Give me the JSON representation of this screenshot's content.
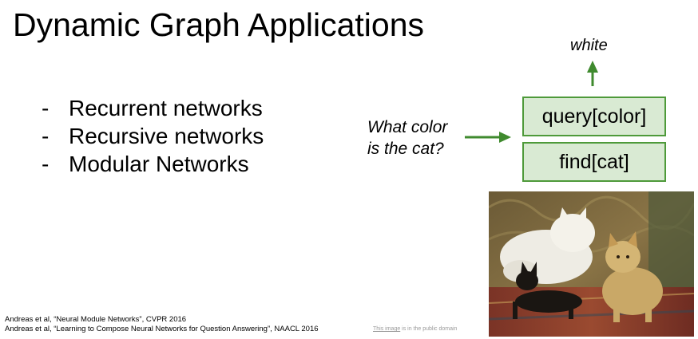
{
  "slide": {
    "title": "Dynamic Graph Applications",
    "bullets": [
      {
        "marker": "-",
        "text": "Recurrent networks"
      },
      {
        "marker": "-",
        "text": "Recursive networks"
      },
      {
        "marker": "-",
        "text": "Modular Networks"
      }
    ]
  },
  "diagram": {
    "question_line1": "What color",
    "question_line2": "is the cat?",
    "answer": "white",
    "modules": [
      {
        "label": "query[color]"
      },
      {
        "label": "find[cat]"
      }
    ],
    "colors": {
      "module_fill": "#d9ead3",
      "module_border": "#4e9a3a",
      "arrow": "#3f8a2e"
    }
  },
  "references": [
    "Andreas et al, “Neural Module Networks”, CVPR 2016",
    "Andreas et al, “Learning to Compose Neural Networks for Question Answering”, NAACL 2016"
  ],
  "image_credit": {
    "link_text": "This image",
    "rest": " is in the public domain"
  }
}
